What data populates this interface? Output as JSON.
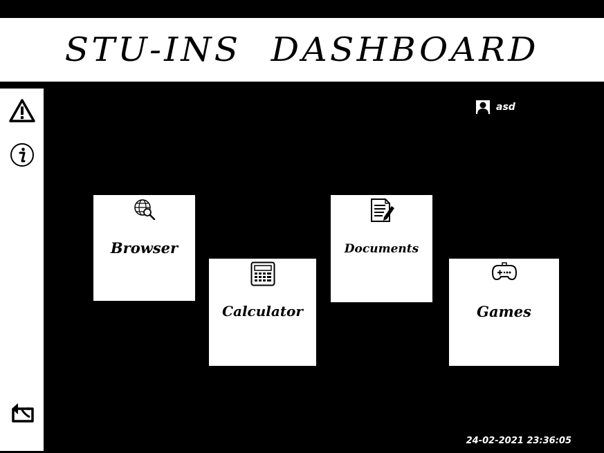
{
  "header": {
    "title": "STU-INS  DASHBOARD"
  },
  "sidebar": {
    "items": [
      {
        "name": "warning-icon"
      },
      {
        "name": "info-icon"
      },
      {
        "name": "logout-icon"
      }
    ]
  },
  "user": {
    "name": "asd",
    "icon": "user-silhouette-icon"
  },
  "tiles": {
    "browser": {
      "label": "Browser",
      "icon": "globe-search-icon"
    },
    "calculator": {
      "label": "Calculator",
      "icon": "calculator-icon"
    },
    "documents": {
      "label": "Documents",
      "icon": "document-edit-icon"
    },
    "games": {
      "label": "Games",
      "icon": "gamepad-icon"
    }
  },
  "status": {
    "datetime": "24-02-2021 23:36:05"
  },
  "colors": {
    "background": "#000000",
    "panel": "#ffffff",
    "text_dark": "#000000",
    "text_light": "#ffffff"
  }
}
